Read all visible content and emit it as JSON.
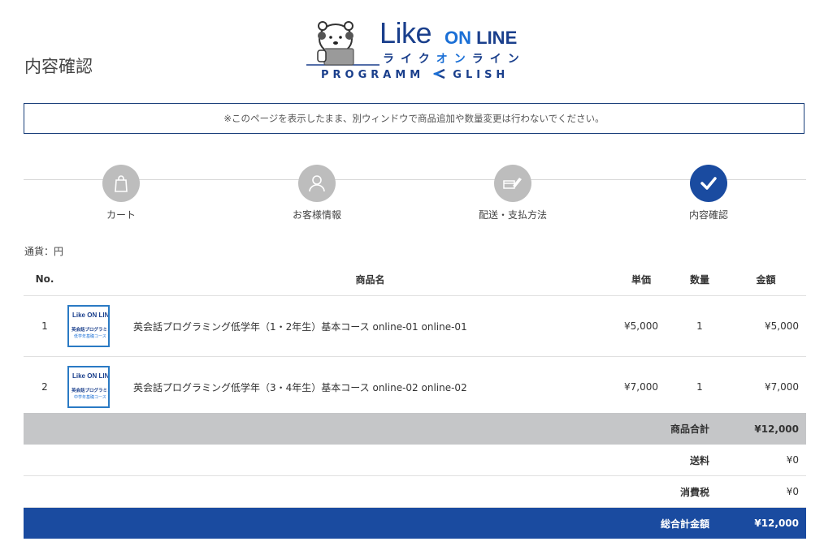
{
  "page": {
    "title": "内容確認"
  },
  "logo": {
    "like": "Like",
    "on": "ON",
    "line": "LINE",
    "kana_a": "ライク",
    "kana_on": "オン",
    "kana_b": "ライン",
    "sub": "PROGRAMM",
    "sub_b": "GLISH"
  },
  "notice": "※このページを表示したまま、別ウィンドウで商品追加や数量変更は行わないでください。",
  "steps": [
    {
      "label": "カート",
      "icon": "bag-icon"
    },
    {
      "label": "お客様情報",
      "icon": "person-icon"
    },
    {
      "label": "配送・支払方法",
      "icon": "card-icon"
    },
    {
      "label": "内容確認",
      "icon": "check-icon"
    }
  ],
  "currency": "通貨：円",
  "table": {
    "headers": {
      "no": "No.",
      "name": "商品名",
      "price": "単価",
      "qty": "数量",
      "amount": "金額"
    },
    "rows": [
      {
        "no": "1",
        "name": "英会話プログラミング低学年（1・2年生）基本コース online-01 online-01",
        "price": "¥5,000",
        "qty": "1",
        "amount": "¥5,000",
        "thumb_title": "英会話プログラミング",
        "thumb_sub": "低学年基礎コース"
      },
      {
        "no": "2",
        "name": "英会話プログラミング低学年（3・4年生）基本コース online-02 online-02",
        "price": "¥7,000",
        "qty": "1",
        "amount": "¥7,000",
        "thumb_title": "英会話プログラミング",
        "thumb_sub": "中学年基礎コース"
      }
    ],
    "thumb_brand": "Like ON LINE"
  },
  "summary": {
    "subtotal_label": "商品合計",
    "subtotal_value": "¥12,000",
    "shipping_label": "送料",
    "shipping_value": "¥0",
    "tax_label": "消費税",
    "tax_value": "¥0",
    "total_label": "総合計金額",
    "total_value": "¥12,000"
  },
  "colors": {
    "accent": "#1a4ba0",
    "step_inactive": "#bdbdbd",
    "subtotal_bg": "#c5c6c8"
  }
}
